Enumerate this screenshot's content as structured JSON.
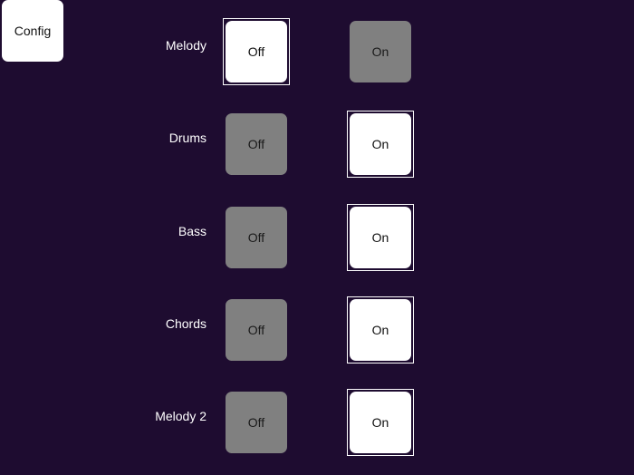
{
  "config": {
    "label": "Config"
  },
  "colors": {
    "background": "#1e0c30",
    "active_button": "#ffffff",
    "inactive_button": "#808080",
    "selected_outline": "#ffffff"
  },
  "tracks": [
    {
      "label": "Melody",
      "off_label": "Off",
      "on_label": "On",
      "state": "off"
    },
    {
      "label": "Drums",
      "off_label": "Off",
      "on_label": "On",
      "state": "on"
    },
    {
      "label": "Bass",
      "off_label": "Off",
      "on_label": "On",
      "state": "on"
    },
    {
      "label": "Chords",
      "off_label": "Off",
      "on_label": "On",
      "state": "on"
    },
    {
      "label": "Melody 2",
      "off_label": "Off",
      "on_label": "On",
      "state": "on"
    }
  ]
}
